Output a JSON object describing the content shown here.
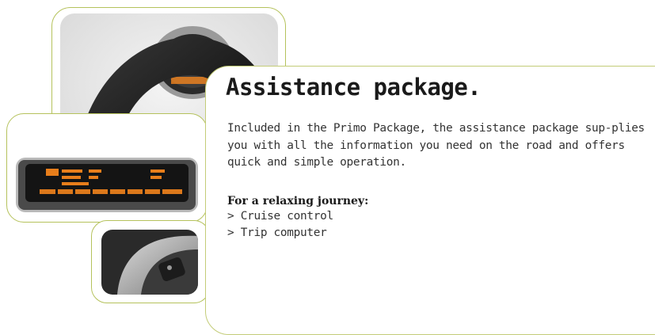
{
  "heading": "Assistance package.",
  "intro": "Included in the Primo Package, the assistance package sup-plies you with all the information you need on the road and offers quick and simple operation.",
  "features": {
    "subheading": "For a relaxing journey:",
    "items": [
      "> Cruise control",
      "> Trip computer"
    ]
  },
  "images": {
    "wheel": "steering-wheel-photo",
    "display": "instrument-display-photo",
    "switch": "cruise-control-switch-photo"
  },
  "colors": {
    "frame": "#b5c25c",
    "display_glow": "#ff8a1c"
  }
}
